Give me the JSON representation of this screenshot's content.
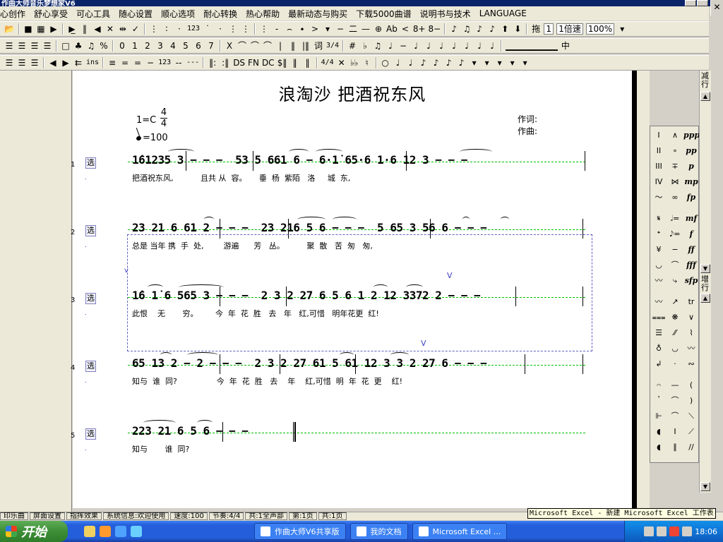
{
  "window": {
    "title": "作曲大师音乐梦想家V6"
  },
  "menubar": [
    "心创作",
    "舒心享受",
    "可心工具",
    "随心设置",
    "顺心选项",
    "耐心转换",
    "热心帮助",
    "最新动态与购买",
    "下载5000曲谱",
    "说明书与技术",
    "LANGUAGE"
  ],
  "toolbar1": {
    "items": [
      "📂",
      "■",
      "▦",
      "▶",
      "▶̲",
      "‖",
      "◀",
      "✕",
      "⇹",
      "✓",
      "⋮",
      "∶",
      "·",
      "123",
      "˙",
      "·",
      "⋮",
      "⋮",
      "⋮",
      "-",
      "⌢",
      "∙",
      ">",
      "▾",
      "−",
      "二",
      "—",
      "⊕",
      "Ab",
      "<",
      "8+",
      "8−",
      "♪",
      "♫",
      "♪",
      "♪",
      "⬆",
      "⬇"
    ],
    "drag_label": "拖",
    "measure_value": "1",
    "speed_value": "1倍速",
    "zoom_value": "100%"
  },
  "toolbar2": {
    "items": [
      "☰",
      "☰",
      "☰",
      "☰",
      "□",
      "♣",
      "♫",
      "%",
      "0",
      "1",
      "2",
      "3",
      "4",
      "5",
      "6",
      "7",
      "X",
      "⌒",
      "⌒",
      "⌒",
      "|",
      "‖",
      "|‖",
      "词",
      "3/4",
      "#",
      "♭",
      "♫",
      "♩",
      "−",
      "♩",
      "♩",
      "♩",
      "♩",
      "♩",
      "♩",
      "♩"
    ],
    "right_label": "中"
  },
  "toolbar3": {
    "items": [
      "☰",
      "☰",
      "☰",
      "◀",
      "▶",
      "⇇",
      "ins",
      "≡",
      "=",
      "=",
      "−",
      "123",
      "--",
      "---",
      "‖:",
      ":‖",
      "DS",
      "FN",
      "DC",
      "$‖",
      "‖",
      "‖",
      "4/4",
      "✕",
      "♭♭",
      "♮",
      "○",
      "♩",
      "♩",
      "♪",
      "♪",
      "♪",
      "♪",
      "▾",
      "▾",
      "▾",
      "▾",
      "▾"
    ]
  },
  "score": {
    "title": "浪淘沙 把酒祝东风",
    "key": "1=C",
    "time_numerator": "4",
    "time_denominator": "4",
    "tempo": "=100",
    "lyricist": "作词:",
    "composer": "作曲:",
    "rows": [
      {
        "num": "1",
        "sel": "选",
        "tiny": ".",
        "notes": "1̇61235 3 − − −  53 5 661 6 − 6·1̇ 65·6 1·6 12 3 − − −",
        "lyrics": "把酒祝东风,           且共 从  容。     垂  杨  紫陌   洛     城  东,"
      },
      {
        "num": "2",
        "sel": "选",
        "tiny": ".",
        "notes": "23 21 6 61 2 − − −  23 216 5 6 − − −  5 65 3 56 6 − − −",
        "lyrics": "总是 当年 携  手  处,        游遍      芳   丛。         聚  散   苦  匆   匆,"
      },
      {
        "num": "3",
        "sel": "选",
        "tiny": ".",
        "notes": "1̇6 1̇ 6 565 3 − − −  2 3 2 27 6 5 6 1 2 12 3372 2 − − −",
        "lyrics": "此恨    无       穷。       今  年  花  胜   去   年   红,可惜   明年花更  红!"
      },
      {
        "num": "4",
        "sel": "选",
        "tiny": ".",
        "notes": "65 13 2 − 2 − − −  2 3 2 27 61 5 61 12 3 3 2 27 6 − − −",
        "lyrics": "知与  谁  同?                今  年  花  胜   去    年    红,可惜  明  年  花  更    红!"
      },
      {
        "num": "5",
        "sel": "选",
        "tiny": ".",
        "notes": "223 21 6 5 6 − − −",
        "lyrics": "知与       谁  同?"
      }
    ]
  },
  "scroll_labels": {
    "top": "减行",
    "mid": "增行"
  },
  "palette": {
    "col1": [
      "I",
      "II",
      "III",
      "IV",
      "〜",
      "",
      "𝄋",
      "𝄌",
      "¥",
      "◡",
      "〰",
      "",
      "〰",
      "⩶",
      "☰",
      "♁",
      "↲",
      "",
      "𝄐",
      "𝄒",
      "⊩",
      "◖",
      "◖"
    ],
    "col2": [
      "∧",
      "∘",
      "∓",
      "⋈",
      "∞",
      "",
      "𝅗𝅥=",
      "𝅘𝅥𝅮=",
      "−",
      "⌒",
      "⤷",
      "",
      "↗",
      "❋",
      "⁄⁄",
      "◡",
      "·",
      "",
      "—",
      "⌒",
      "⌒",
      "I",
      "∥"
    ],
    "col3": [
      "ppp",
      "pp",
      "p",
      "mp",
      "fp",
      "",
      "mf",
      "f",
      "ff",
      "fff",
      "sfp",
      "",
      "tr",
      "∨",
      "⌇",
      "〰",
      "∾",
      "",
      "(",
      ")",
      "⟍",
      "⟋",
      "//"
    ]
  },
  "status": [
    "印乐曲",
    "屏面设置",
    "指挥效果",
    "系统信息:欢迎使用",
    "速度:100",
    "节奏:4/4",
    "共:1全声部",
    "第:1页",
    "共:1页"
  ],
  "tooltip": "Microsoft Excel - 新建 Microsoft Excel 工作表",
  "taskbar": {
    "start": "开始",
    "tasks": [
      "作曲大师V6共享版",
      "我的文档",
      "Microsoft Excel ..."
    ],
    "clock": "18:06"
  }
}
